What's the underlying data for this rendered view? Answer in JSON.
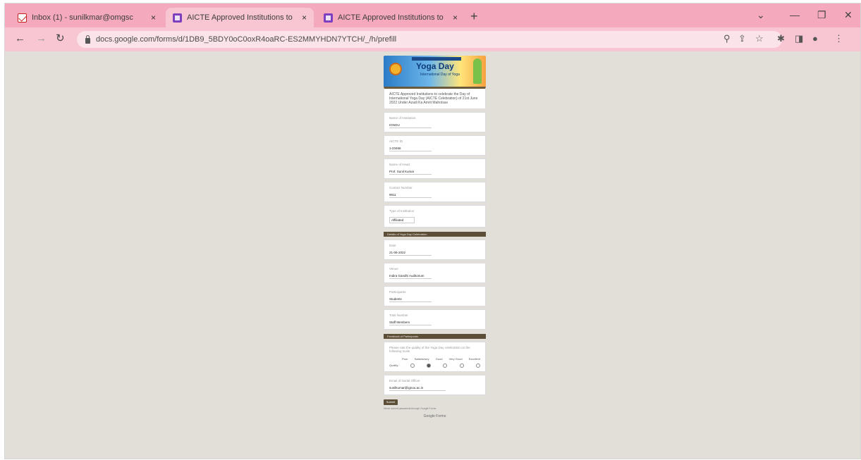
{
  "browser": {
    "tabs": [
      {
        "title": "Inbox (1) - sunilkmar@omgsc",
        "favicon": "gmail-icon",
        "active": false
      },
      {
        "title": "AICTE Approved Institutions to",
        "favicon": "forms-icon",
        "active": true
      },
      {
        "title": "AICTE Approved Institutions to",
        "favicon": "forms-icon",
        "active": false
      }
    ],
    "new_tab_label": "+",
    "close_glyph": "×",
    "url": "docs.google.com/forms/d/1DB9_5BDY0oC0oxR4oaRC-ES2MMYHDN7YTCH/_/h/prefill"
  },
  "form": {
    "banner_title": "Yoga Day",
    "banner_subtitle": "International Day of Yoga",
    "intro": "AICTE Approved Institutions to celebrate the Day of International Yoga Day (AICTE Celebration) of 21st June 2022 Under Azadi Ka Amrit Mahotsav",
    "fields": [
      {
        "label": "Name of Institution",
        "value": "IGNOU"
      },
      {
        "label": "AICTE ID",
        "value": "1-23456"
      },
      {
        "label": "Name of Head",
        "value": "Prof. Sunil Kumar"
      },
      {
        "label": "Contact Number",
        "value": "9811"
      },
      {
        "label": "Type of Institution",
        "value": "Affiliated"
      }
    ],
    "section1_title": "Details of Yoga Day Celebration",
    "fields2": [
      {
        "label": "Date",
        "value": "21-06-2022"
      },
      {
        "label": "Venue",
        "value": "Indira Gandhi Auditorium"
      },
      {
        "label": "Participants",
        "value": "Students"
      },
      {
        "label": "Total Number",
        "value": "Staff Members"
      }
    ],
    "section2_title": "Feedback of Participants",
    "grid_question": "Please rate the quality of the Yoga Day celebration on the following scale",
    "grid_headers": [
      "Poor",
      "Satisfactory",
      "Good",
      "Very Good",
      "Excellent"
    ],
    "grid_row_label": "Quality",
    "email_label": "Email of Nodal Officer",
    "email_value": "sunilkumar@ignou.ac.in",
    "submit_label": "Submit",
    "footer_note": "Never submit passwords through Google Forms.",
    "footer_logo": "Google Forms"
  }
}
